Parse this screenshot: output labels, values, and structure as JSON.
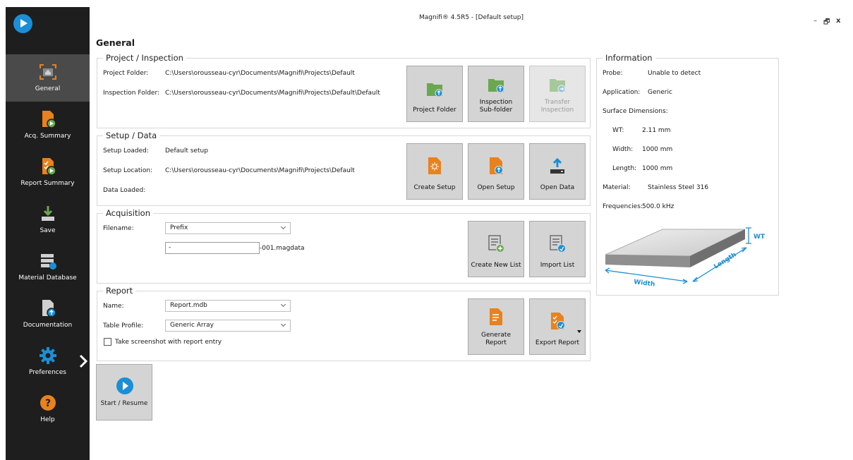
{
  "window": {
    "title": "Magnifi® 4.5R5 - [Default setup]",
    "minimize": "–",
    "restore": "🗗",
    "close": "x"
  },
  "sidebar": {
    "items": [
      {
        "label": "General",
        "icon": "general-folder-icon",
        "active": true
      },
      {
        "label": "Acq. Summary",
        "icon": "acq-summary-icon"
      },
      {
        "label": "Report Summary",
        "icon": "report-summary-icon"
      },
      {
        "label": "Save",
        "icon": "save-icon"
      },
      {
        "label": "Material Database",
        "icon": "material-database-icon"
      },
      {
        "label": "Documentation",
        "icon": "documentation-icon"
      },
      {
        "label": "Preferences",
        "icon": "gear-icon"
      },
      {
        "label": "Help",
        "icon": "help-icon"
      }
    ]
  },
  "page": {
    "title": "General"
  },
  "project": {
    "title": "Project / Inspection",
    "folder_label": "Project Folder:",
    "folder_value": "C:\\Users\\orousseau-cyr\\Documents\\Magnifi\\Projects\\Default",
    "inspection_label": "Inspection Folder:",
    "inspection_value": "C:\\Users\\orousseau-cyr\\Documents\\Magnifi\\Projects\\Default\\Default",
    "btn_project_folder": "Project Folder",
    "btn_inspection_line1": "Inspection",
    "btn_inspection_line2": "Sub-folder",
    "btn_transfer_line1": "Transfer",
    "btn_transfer_line2": "Inspection"
  },
  "setup": {
    "title": "Setup / Data",
    "loaded_label": "Setup Loaded:",
    "loaded_value": "Default setup",
    "location_label": "Setup Location:",
    "location_value": "C:\\Users\\orousseau-cyr\\Documents\\Magnifi\\Projects\\Default",
    "data_label": "Data Loaded:",
    "btn_create": "Create Setup",
    "btn_open": "Open Setup",
    "btn_open_data": "Open Data"
  },
  "acquisition": {
    "title": "Acquisition",
    "filename_label": "Filename:",
    "filename_mode": "Prefix",
    "filename_value": "-",
    "filename_suffix": "-001.magdata",
    "btn_create_list": "Create New List",
    "btn_import_list": "Import List"
  },
  "report": {
    "title": "Report",
    "name_label": "Name:",
    "name_value": "Report.mdb",
    "profile_label": "Table Profile:",
    "profile_value": "Generic Array",
    "screenshot_label": "Take screenshot with report entry",
    "btn_generate_line1": "Generate",
    "btn_generate_line2": "Report",
    "btn_export": "Export Report"
  },
  "start": {
    "label": "Start / Resume"
  },
  "information": {
    "title": "Information",
    "probe_label": "Probe:",
    "probe_value": "Unable to detect",
    "application_label": "Application:",
    "application_value": "Generic",
    "surface_label": "Surface Dimensions:",
    "wt_label": "WT:",
    "wt_value": "2.11 mm",
    "width_label": "Width:",
    "width_value": "1000 mm",
    "length_label": "Length:",
    "length_value": "1000 mm",
    "material_label": "Material:",
    "material_value": "Stainless Steel 316",
    "freq_label": "Frequencies:",
    "freq_value": "500.0 kHz",
    "diagram_wt": "WT",
    "diagram_width": "Width",
    "diagram_length": "Length"
  },
  "colors": {
    "accent_blue": "#1a8fd6",
    "accent_orange": "#e8821e",
    "folder_green": "#6aa84f",
    "sidebar_bg": "#1e1e1e"
  }
}
